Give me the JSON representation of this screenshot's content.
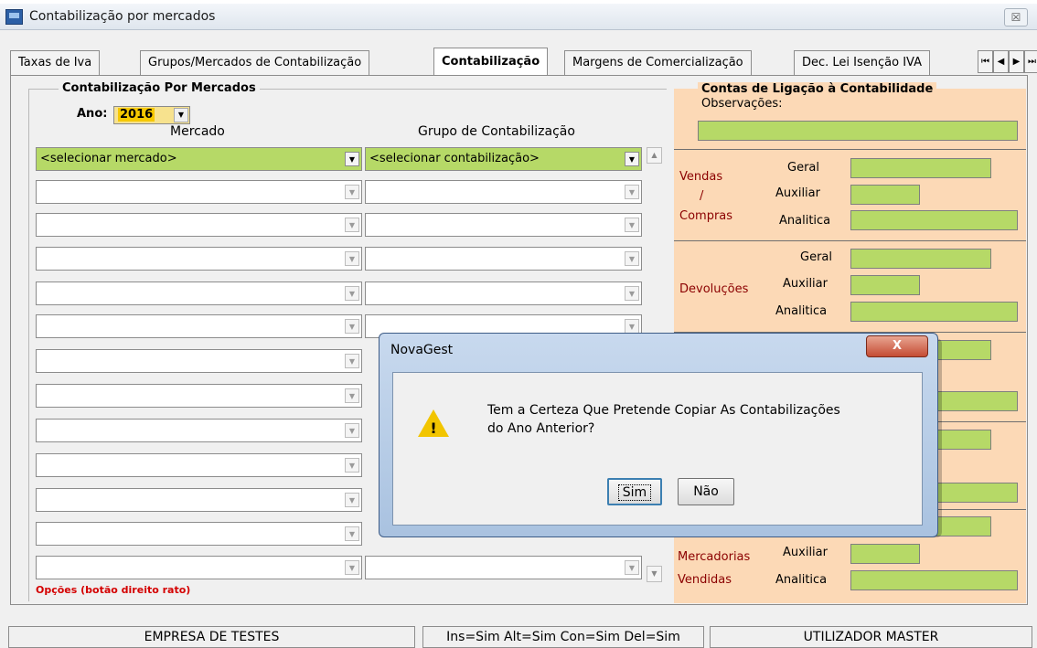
{
  "window": {
    "title": "Contabilização por mercados",
    "close": "☒"
  },
  "tabs": [
    {
      "label": "Taxas de Iva"
    },
    {
      "label": "Grupos/Mercados de Contabilização"
    },
    {
      "label": "Contabilização"
    },
    {
      "label": "Margens de Comercialização"
    },
    {
      "label": "Dec. Lei Isenção IVA"
    }
  ],
  "tab_nav": {
    "first": "⏮",
    "prev": "◀",
    "next": "▶",
    "last": "⏭"
  },
  "left": {
    "group_title": "Contabilização Por Mercados",
    "ano_label": "Ano:",
    "ano_value": "2016",
    "col_mercado": "Mercado",
    "col_grupo": "Grupo de Contabilização",
    "first_row": {
      "mercado": "<selecionar mercado>",
      "grupo": "<selecionar contabilização>"
    },
    "opcoes_hint": "Opções (botão direito rato)"
  },
  "right": {
    "group_title": "Contas de Ligação à Contabilidade",
    "observacoes": "Observações:",
    "vendas": "Vendas",
    "slash": "/",
    "compras": "Compras",
    "devolucoes": "Devoluções",
    "mercadorias": "Mercadorias",
    "vendidas": "Vendidas",
    "geral": "Geral",
    "auxiliar": "Auxiliar",
    "analitica": "Analitica"
  },
  "status": {
    "empresa": "EMPRESA DE TESTES",
    "permissions": "Ins=Sim Alt=Sim Con=Sim Del=Sim",
    "utilizador": "UTILIZADOR MASTER"
  },
  "dialog": {
    "title": "NovaGest",
    "close": "X",
    "line1": "Tem a Certeza Que Pretende Copiar As Contabilizações",
    "line2": "do Ano Anterior?",
    "yes_label": "Sim",
    "no_label": "Não",
    "icon": "warning-icon"
  }
}
